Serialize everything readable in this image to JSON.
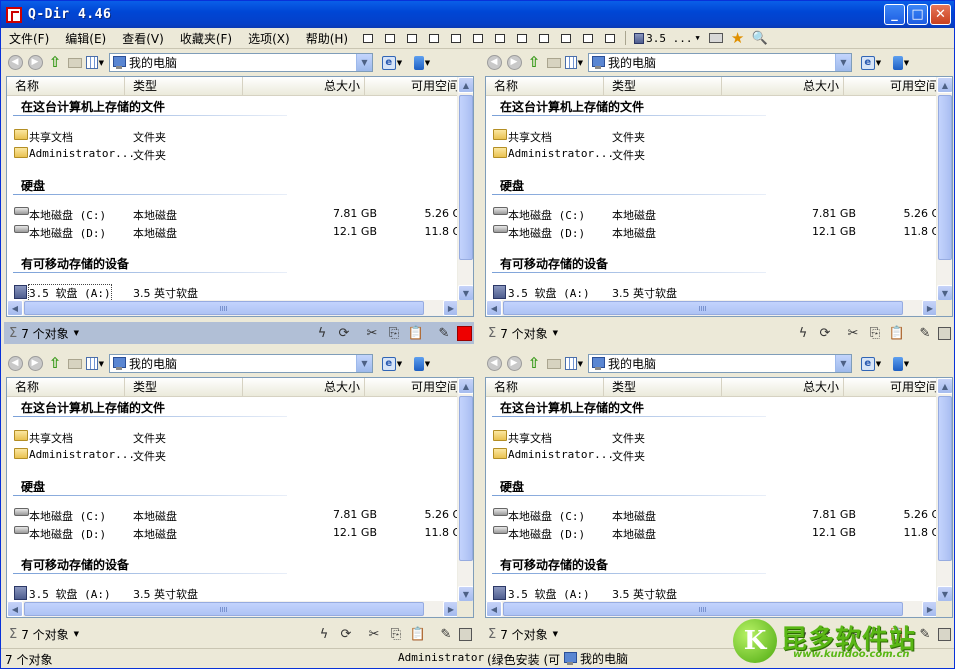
{
  "window": {
    "title": "Q-Dir 4.46"
  },
  "menu": [
    {
      "label": "文件(F)"
    },
    {
      "label": "编辑(E)"
    },
    {
      "label": "查看(V)"
    },
    {
      "label": "收藏夹(F)"
    },
    {
      "label": "选项(X)"
    },
    {
      "label": "帮助(H)"
    }
  ],
  "toolbar": {
    "drive_label": "3.5 ..."
  },
  "columns": [
    "名称",
    "类型",
    "总大小",
    "可用空间"
  ],
  "address": "我的电脑",
  "groups": {
    "stored": "在这台计算机上存储的文件",
    "disks": "硬盘",
    "removable": "有可移动存储的设备"
  },
  "items": {
    "shared": {
      "name": "共享文档",
      "type": "文件夹"
    },
    "admin": {
      "name": "Administrator...",
      "type": "文件夹"
    },
    "c": {
      "name": "本地磁盘 (C:)",
      "type": "本地磁盘",
      "total": "7.81 GB",
      "free": "5.26 G"
    },
    "d": {
      "name": "本地磁盘 (D:)",
      "type": "本地磁盘",
      "total": "12.1 GB",
      "free": "11.8 G"
    },
    "a": {
      "name": "3.5 软盘 (A:)",
      "type": "3.5 英寸软盘"
    }
  },
  "pane_status": "7 个对象",
  "status": {
    "objects": "7 个对象",
    "user": "Administrator",
    "note": "(绿色安装 (可",
    "location": "我的电脑"
  },
  "watermark": {
    "brand": "昆多软件站",
    "url": "www.kundoo.com.cn"
  },
  "colors": {
    "titlebar": "#0054e3",
    "active_pane_status": "#b1bfd6",
    "accent": "#e00000"
  }
}
